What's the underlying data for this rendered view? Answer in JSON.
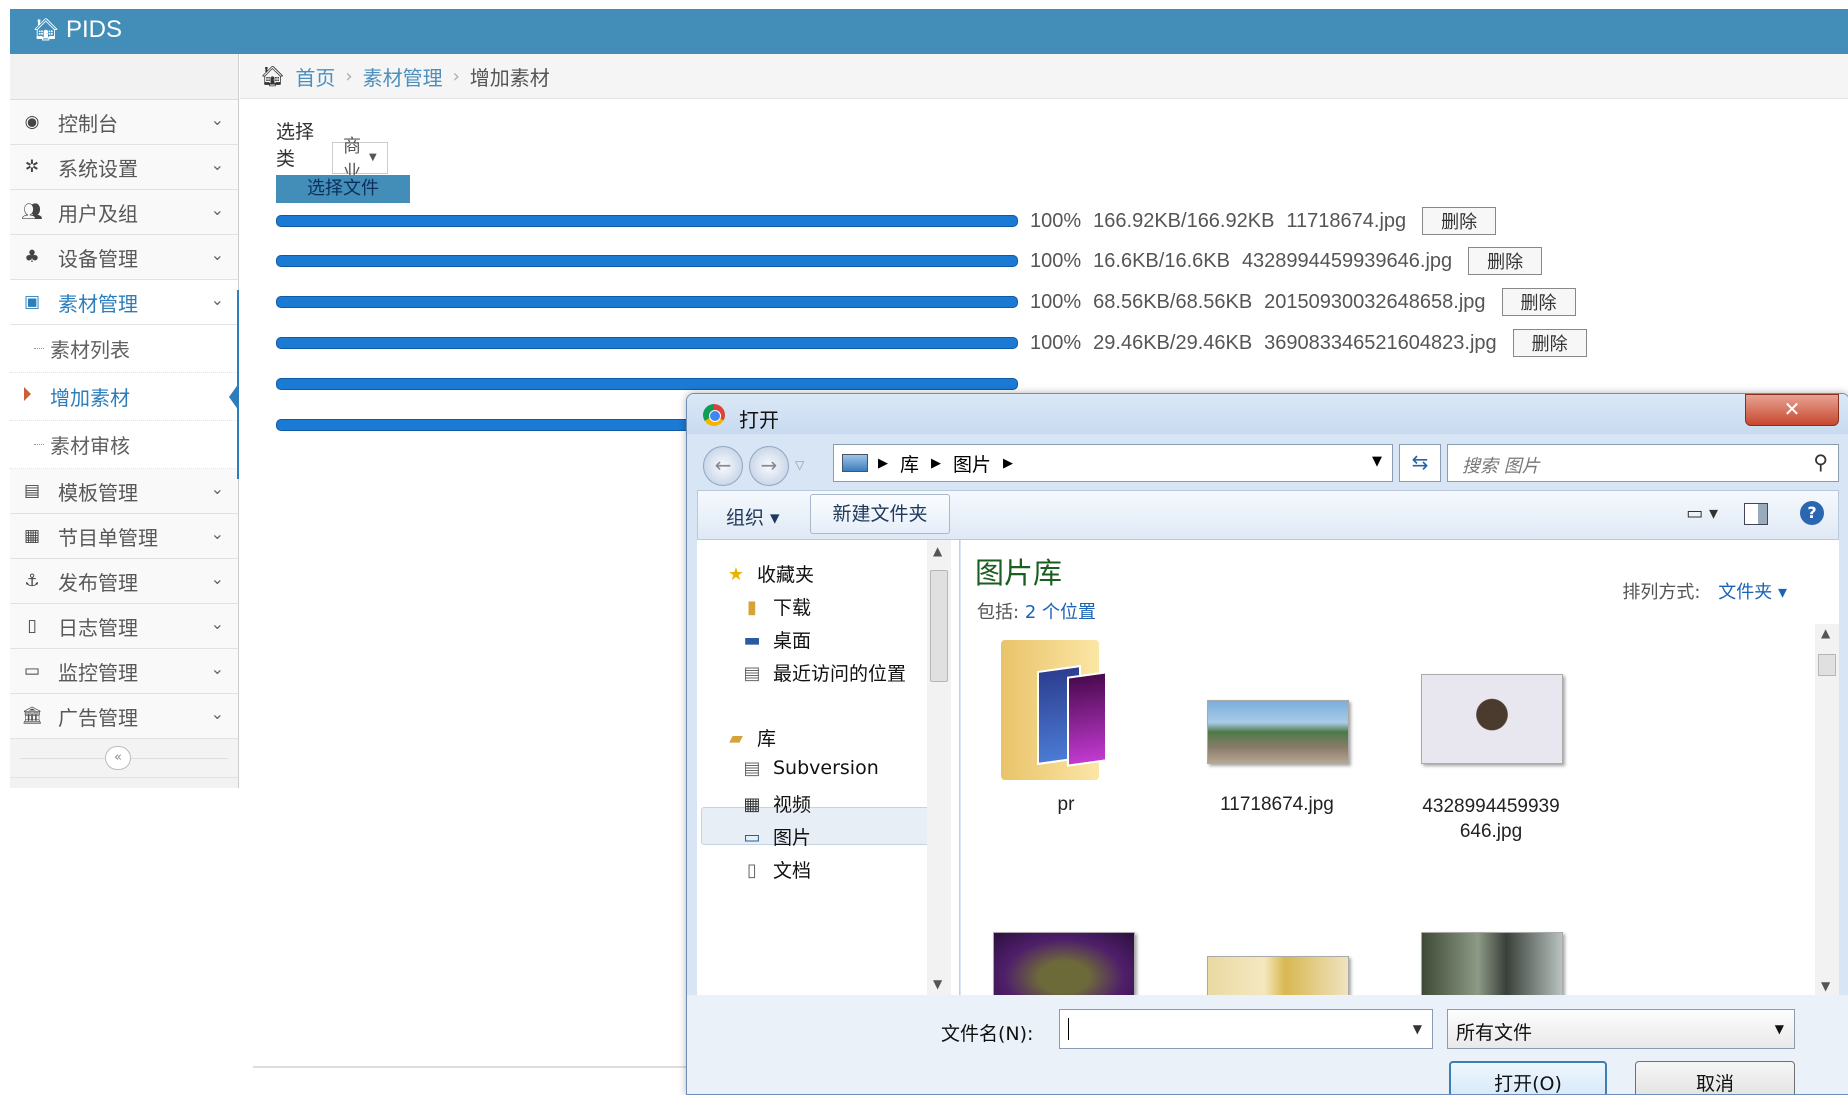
{
  "app": {
    "title": "PIDS"
  },
  "breadcrumb": {
    "home": "首页",
    "section": "素材管理",
    "current": "增加素材"
  },
  "sidebar": {
    "items": [
      {
        "label": "控制台",
        "icon": "dashboard-icon"
      },
      {
        "label": "系统设置",
        "icon": "cog-icon"
      },
      {
        "label": "用户及组",
        "icon": "users-icon"
      },
      {
        "label": "设备管理",
        "icon": "sitemap-icon"
      },
      {
        "label": "素材管理",
        "icon": "media-icon",
        "open": true
      },
      {
        "label": "模板管理",
        "icon": "template-icon"
      },
      {
        "label": "节目单管理",
        "icon": "film-icon"
      },
      {
        "label": "发布管理",
        "icon": "anchor-icon"
      },
      {
        "label": "日志管理",
        "icon": "log-icon"
      },
      {
        "label": "监控管理",
        "icon": "monitor-icon"
      },
      {
        "label": "广告管理",
        "icon": "bank-icon"
      }
    ],
    "subitems": [
      {
        "label": "素材列表"
      },
      {
        "label": "增加素材",
        "active": true
      },
      {
        "label": "素材审核"
      }
    ],
    "collapse": "«"
  },
  "main": {
    "category_label": "选择类别：",
    "category_value": "商业",
    "choose_button": "选择文件",
    "delete_label": "删除",
    "files": [
      {
        "percent": "100%",
        "size": "166.92KB/166.92KB",
        "name": "11718674.jpg",
        "progress": 1.0
      },
      {
        "percent": "100%",
        "size": "16.6KB/16.6KB",
        "name": "4328994459939646.jpg",
        "progress": 1.0
      },
      {
        "percent": "100%",
        "size": "68.56KB/68.56KB",
        "name": "20150930032648658.jpg",
        "progress": 1.0
      },
      {
        "percent": "100%",
        "size": "29.46KB/29.46KB",
        "name": "369083346521604823.jpg",
        "progress": 1.0
      },
      {
        "progress": 1.0
      },
      {
        "progress": 1.0
      }
    ]
  },
  "dialog": {
    "title": "打开",
    "close": "✕",
    "address": [
      "库",
      "图片"
    ],
    "search_placeholder": "搜索 图片",
    "toolbar": {
      "organize": "组织 ▾",
      "new_folder": "新建文件夹"
    },
    "nav": {
      "favorites": "收藏夹",
      "downloads": "下载",
      "desktop": "桌面",
      "recent": "最近访问的位置",
      "libraries": "库",
      "subversion": "Subversion",
      "videos": "视频",
      "pictures": "图片",
      "documents": "文档"
    },
    "library": {
      "title": "图片库",
      "includes_label": "包括:",
      "includes_link": "2 个位置",
      "sort_label": "排列方式:",
      "sort_value": "文件夹 ▾"
    },
    "items": [
      {
        "name": "pr",
        "kind": "folder"
      },
      {
        "name": "11718674.jpg",
        "kind": "image"
      },
      {
        "name": "4328994459939646.jpg",
        "kind": "image",
        "line1": "4328994459939",
        "line2": "646.jpg"
      }
    ],
    "filename_label": "文件名(N):",
    "filename_value": "",
    "filetype": "所有文件",
    "open_button": "打开(O)",
    "cancel_button": "取消"
  }
}
